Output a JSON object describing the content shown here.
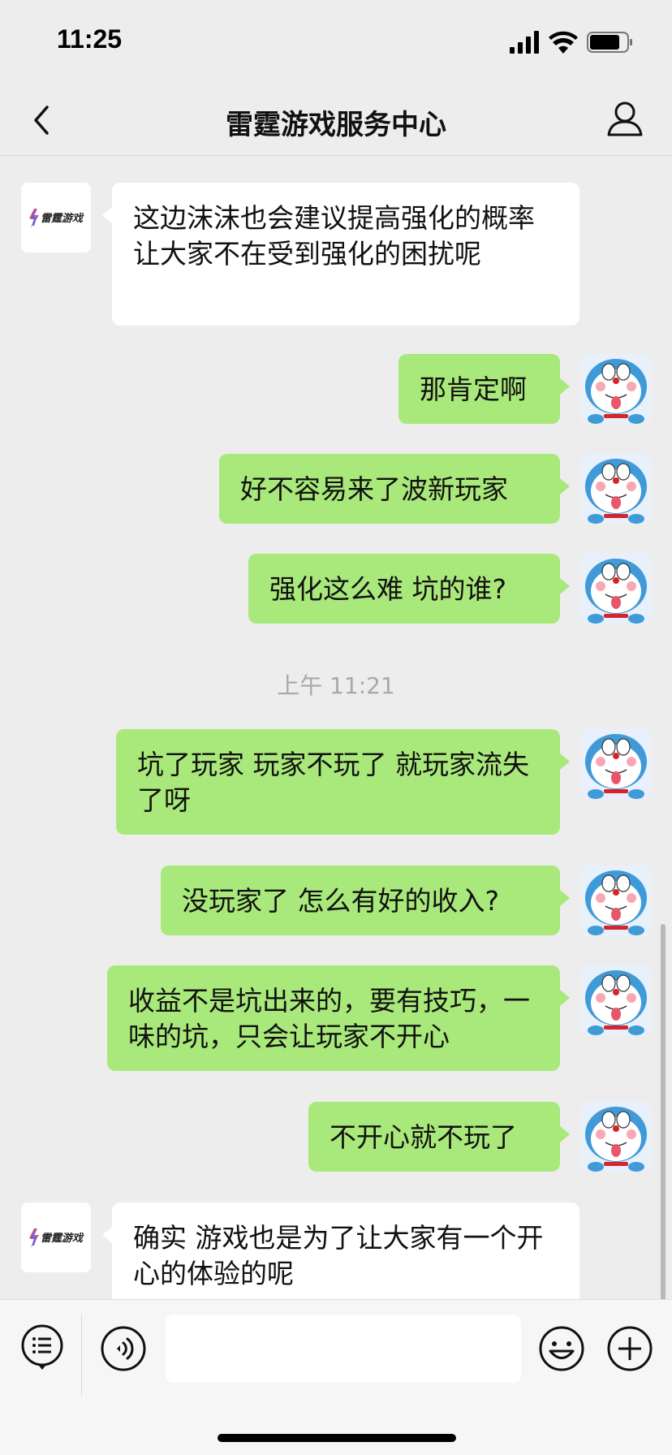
{
  "status": {
    "time": "11:25"
  },
  "header": {
    "title": "雷霆游戏服务中心"
  },
  "brand": {
    "logo_text": "雷霆游戏"
  },
  "messages": [
    {
      "side": "left",
      "text": "这边沫沫也会建议提高强化的概率 让大家不在受到强化的困扰呢"
    },
    {
      "side": "right",
      "text": "那肯定啊"
    },
    {
      "side": "right",
      "text": "好不容易来了波新玩家"
    },
    {
      "side": "right",
      "text": "强化这么难 坑的谁?"
    },
    {
      "side": "right",
      "text": "坑了玩家 玩家不玩了 就玩家流失了呀"
    },
    {
      "side": "right",
      "text": "没玩家了 怎么有好的收入?"
    },
    {
      "side": "right",
      "text": "收益不是坑出来的，要有技巧，一味的坑，只会让玩家不开心"
    },
    {
      "side": "right",
      "text": "不开心就不玩了"
    },
    {
      "side": "left",
      "text": "确实 游戏也是为了让大家有一个开心的体验的呢"
    }
  ],
  "timestamp": "上午 11:21",
  "input": {
    "placeholder": ""
  },
  "colors": {
    "bubble_self": "#a9e87a",
    "bubble_other": "#ffffff",
    "background": "#ededed"
  },
  "icons": {
    "back": "chevron-left-icon",
    "profile": "person-icon",
    "menu": "list-menu-icon",
    "voice": "voice-icon",
    "emoji": "smiley-icon",
    "more": "plus-icon"
  }
}
